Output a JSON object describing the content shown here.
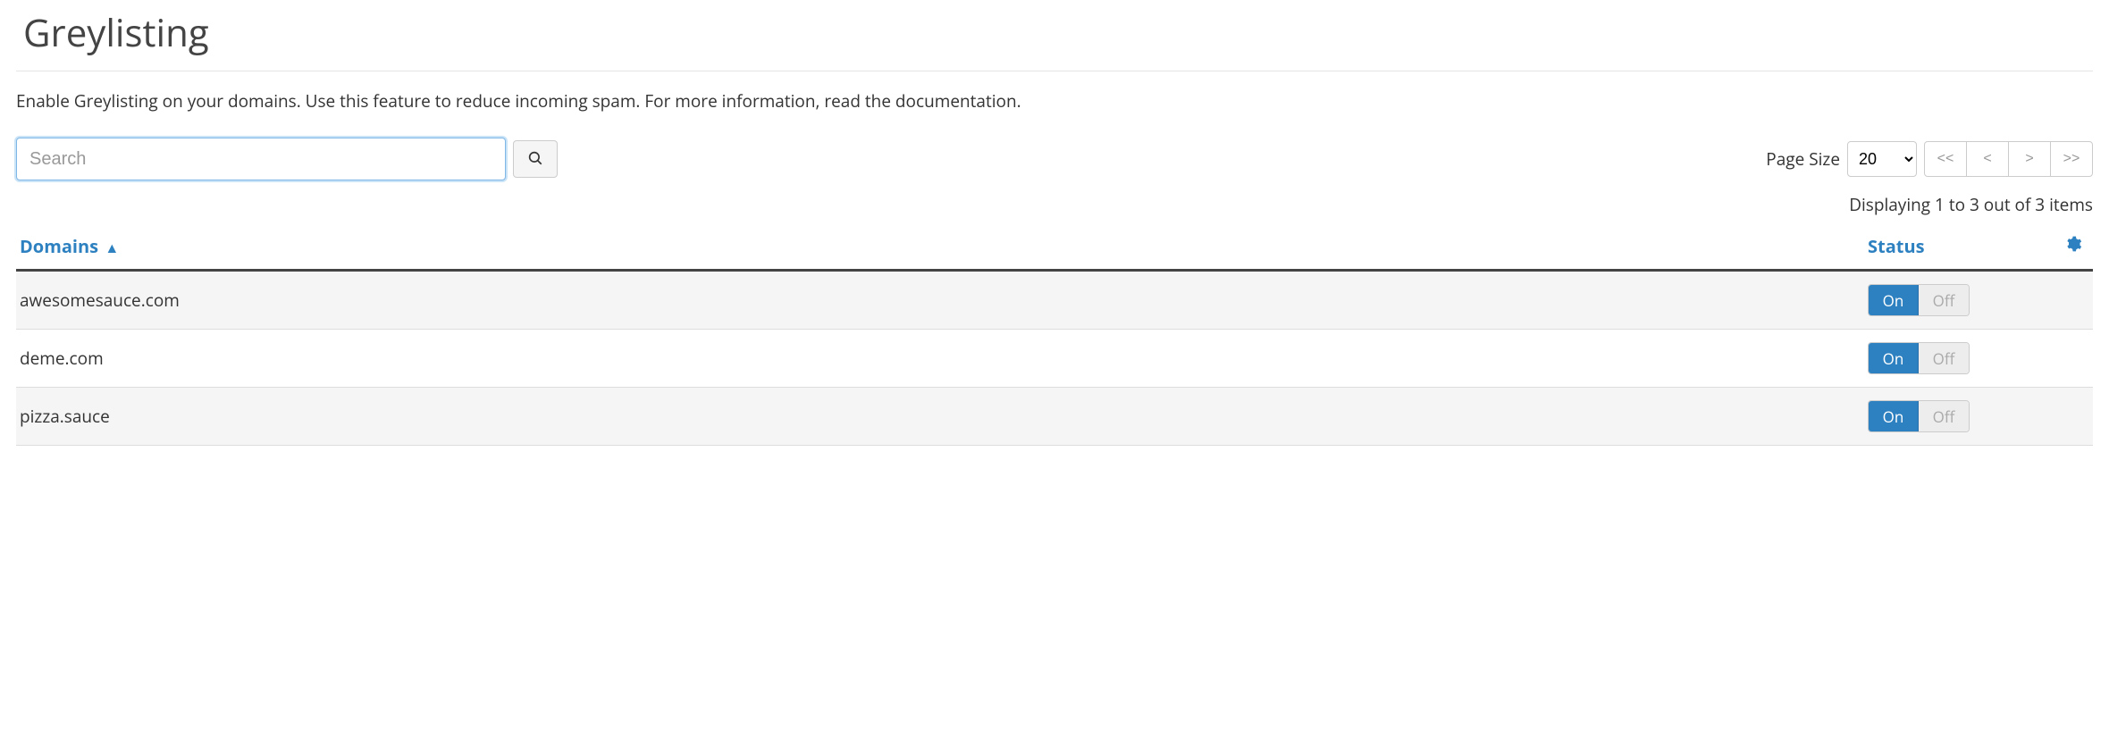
{
  "page": {
    "title": "Greylisting",
    "description": "Enable Greylisting on your domains. Use this feature to reduce incoming spam. For more information, read the documentation."
  },
  "search": {
    "placeholder": "Search",
    "value": ""
  },
  "pager": {
    "label": "Page Size",
    "page_size": "20",
    "first": "<<",
    "prev": "<",
    "next": ">",
    "last": ">>",
    "display_text": "Displaying 1 to 3 out of 3 items"
  },
  "table": {
    "columns": {
      "domain": "Domains",
      "status": "Status"
    },
    "sort_indicator": "▲",
    "toggle": {
      "on": "On",
      "off": "Off"
    },
    "rows": [
      {
        "domain": "awesomesauce.com",
        "status": "on"
      },
      {
        "domain": "deme.com",
        "status": "on"
      },
      {
        "domain": "pizza.sauce",
        "status": "on"
      }
    ]
  }
}
